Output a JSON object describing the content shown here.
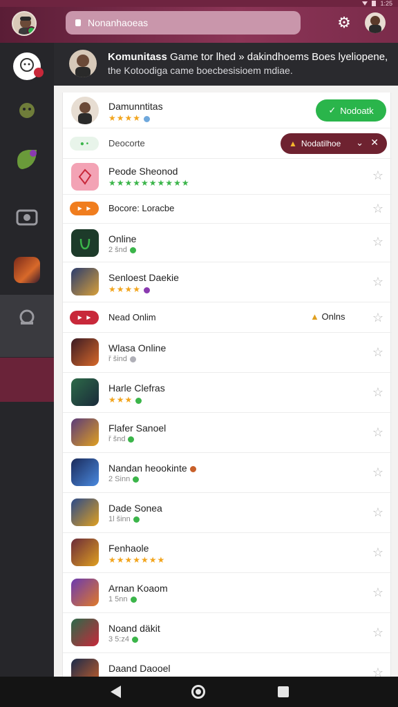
{
  "status_bar": {
    "time": "1:25"
  },
  "topbar": {
    "search_placeholder": "Nonanhaoeas",
    "settings_icon": "gear-icon"
  },
  "header": {
    "title": "Komunitass",
    "title_rest": " Game tor lhed » dakindhoems Boes lyeliopene,",
    "subtitle": "the Kotoodiga came boecbesisioem mdiae."
  },
  "list": {
    "top_item": {
      "name": "Damunntitas",
      "button_label": "Nodoatk"
    },
    "filter_item": {
      "label": "Deocorte",
      "notification_label": "Nodatilhoe"
    },
    "items": [
      {
        "name": "Peode Sheonod",
        "meta": "",
        "stars": "★★★★★★★★★★",
        "star_color": "green",
        "icon_color": "#f3a3b5"
      },
      {
        "name": "Bocore: Loracbe",
        "meta": "",
        "stars": "",
        "tag_color": "#f07d1e",
        "pill": true
      },
      {
        "name": "Online",
        "meta": "2 šnd",
        "stars": "",
        "icon_color": "#1d3b2a"
      },
      {
        "name": "Senloest Daekie",
        "meta": "",
        "stars": "★★★★",
        "icon_color": "#2a3c6e"
      },
      {
        "name": "Nead Onlim",
        "meta": "",
        "stars": "",
        "status": "Onlns",
        "tag_color": "#c8283a",
        "pill": true
      },
      {
        "name": "Wlasa Online",
        "meta": "ř šind",
        "stars": "",
        "icon_color": "#3a1a24"
      },
      {
        "name": "Harle Clefras",
        "meta": "",
        "stars": "★★★",
        "icon_color": "#2d6a48"
      },
      {
        "name": "Flafer Sanoel",
        "meta": "ř šnd",
        "stars": "",
        "icon_color": "#5a3a7a"
      },
      {
        "name": "Nandan heookinte",
        "meta": "2 Sinn",
        "stars": "",
        "icon_color": "#1a2a5a"
      },
      {
        "name": "Dade Sonea",
        "meta": "1l šinn",
        "stars": "",
        "icon_color": "#2a4a8a"
      },
      {
        "name": "Fenhaole",
        "meta": "",
        "stars": "★★★★★★★",
        "icon_color": "#6a2a3a"
      },
      {
        "name": "Arnan Koaom",
        "meta": "1 5nn",
        "stars": "",
        "icon_color": "#6a3ab0"
      },
      {
        "name": "Noand däkit",
        "meta": "3 5:z4",
        "stars": "",
        "icon_color": "#2a6a4a"
      },
      {
        "name": "Daand Daooel",
        "meta": "",
        "stars": "",
        "icon_color": "#1a2a4a"
      }
    ]
  }
}
